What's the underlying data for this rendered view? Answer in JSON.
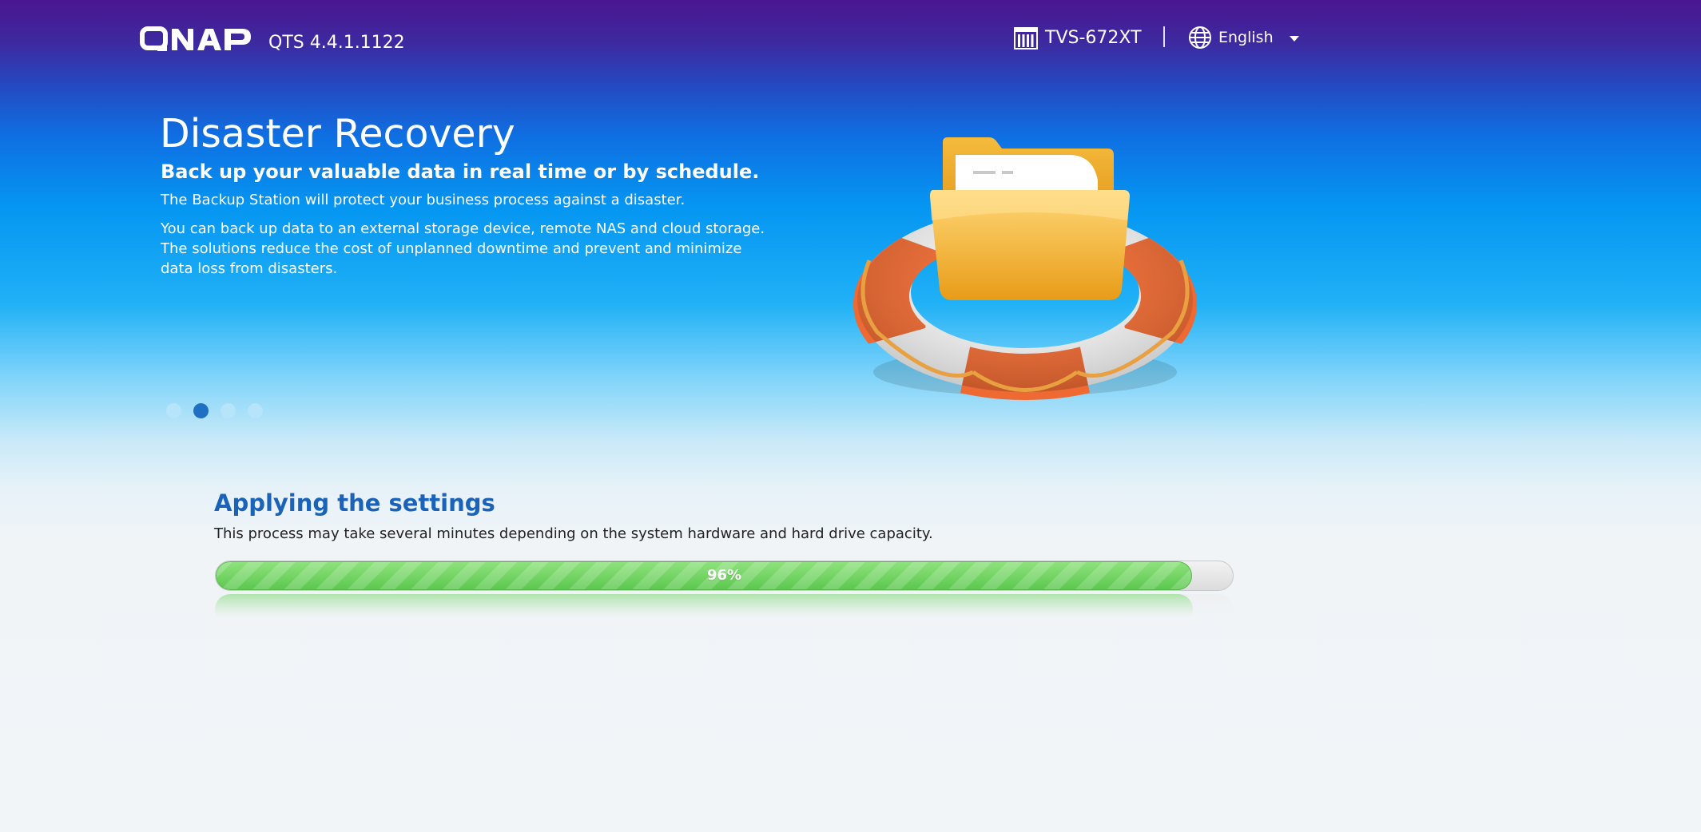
{
  "header": {
    "logo_text": "QNAP",
    "firmware_version": "QTS 4.4.1.1122",
    "device_name": "TVS-672XT",
    "device_icon": "nas-device-icon",
    "language": {
      "icon": "globe-icon",
      "selected": "English"
    }
  },
  "slide": {
    "title": "Disaster Recovery",
    "subtitle": "Back up your valuable data in real time or by schedule.",
    "description_1": "The Backup Station will protect your business process against a disaster.",
    "description_2": "You can back up data to an external storage device, remote NAS and cloud storage. The solutions reduce the cost of unplanned downtime and prevent and minimize data loss from disasters.",
    "illustration": "lifebuoy-folder-illustration",
    "slide_count": 4,
    "active_slide_index": 1
  },
  "progress": {
    "title": "Applying the settings",
    "description": "This process may take several minutes depending on the system hardware and hard drive capacity.",
    "percent": 96,
    "percent_label": "96%"
  },
  "colors": {
    "header_top": "#4a1690",
    "accent_blue": "#1a63b8",
    "progress_green": "#6cd25e",
    "active_dot": "#1f6fc3",
    "inactive_dot": "#b5e4fb"
  }
}
